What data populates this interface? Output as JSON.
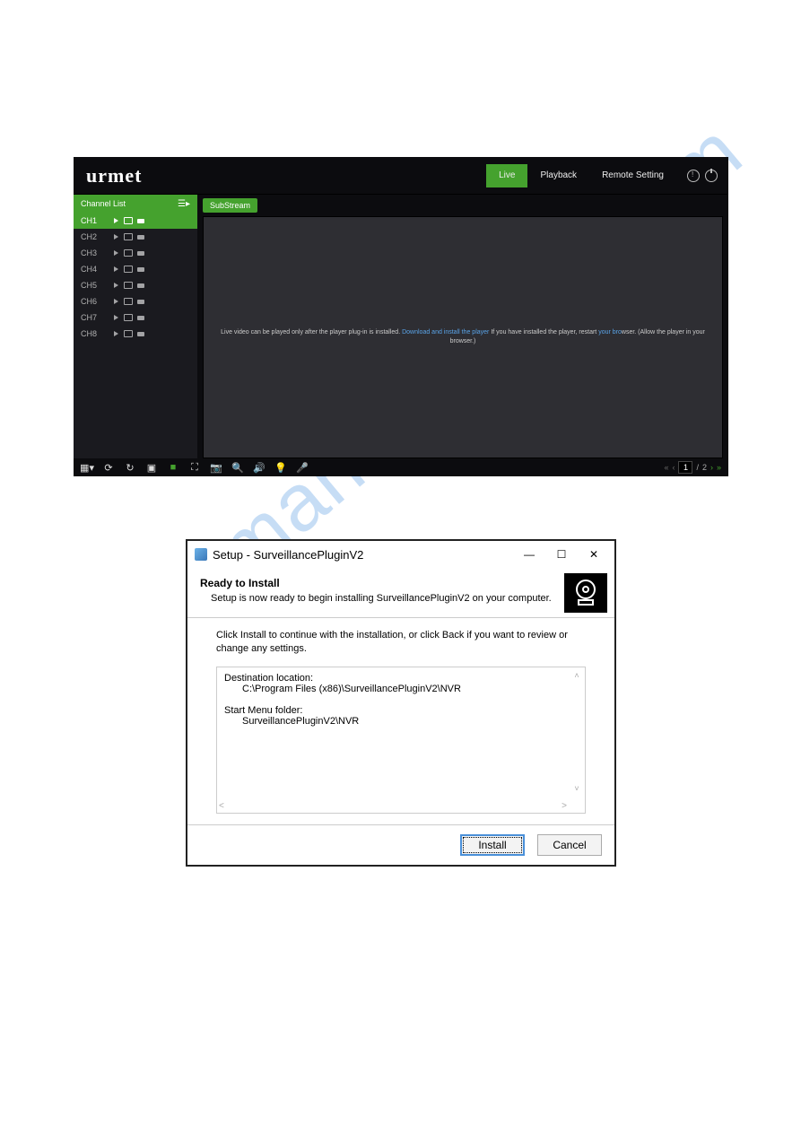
{
  "watermark": "manualshive.com",
  "nvr": {
    "logo": "urmet",
    "nav": {
      "live": "Live",
      "playback": "Playback",
      "remote": "Remote Setting"
    },
    "sidebar": {
      "header": "Channel List",
      "channels": [
        "CH1",
        "CH2",
        "CH3",
        "CH4",
        "CH5",
        "CH6",
        "CH7",
        "CH8"
      ],
      "active_index": 0
    },
    "stream_btn": "SubStream",
    "video_msg": {
      "t1": "Live video can be played only after the player plug-in is installed.",
      "link1": "Download and install the player",
      "t2": "If you have installed the player, restart ",
      "link2": "your bro",
      "t3": "wser. (Allow the player in your browser.)"
    },
    "pager": {
      "current": "1",
      "sep": "/",
      "total": "2"
    }
  },
  "installer": {
    "title": "Setup - SurveillancePluginV2",
    "header_title": "Ready to Install",
    "header_sub": "Setup is now ready to begin installing SurveillancePluginV2 on your computer.",
    "instruction": "Click Install to continue with the installation, or click Back if you want to review or change any settings.",
    "summary": {
      "dest_label": "Destination location:",
      "dest_path": "C:\\Program Files (x86)\\SurveillancePluginV2\\NVR",
      "menu_label": "Start Menu folder:",
      "menu_path": "SurveillancePluginV2\\NVR"
    },
    "buttons": {
      "install": "Install",
      "cancel": "Cancel"
    }
  }
}
